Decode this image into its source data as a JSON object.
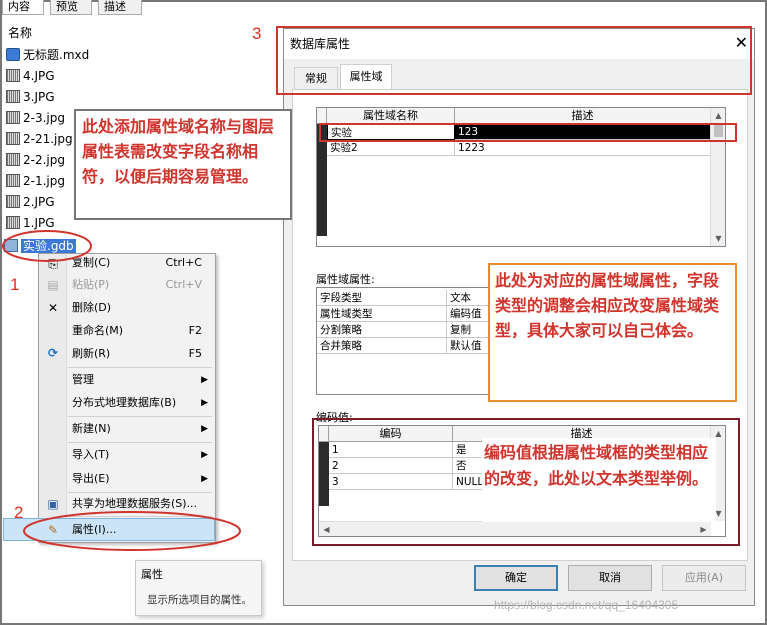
{
  "catalog": {
    "tabs": [
      "内容",
      "预览",
      "描述"
    ],
    "header": "名称",
    "items": [
      {
        "label": "无标题.mxd",
        "icon": "mxd-document-icon"
      },
      {
        "label": "4.JPG",
        "icon": "raster-icon"
      },
      {
        "label": "3.JPG",
        "icon": "raster-icon"
      },
      {
        "label": "2-3.jpg",
        "icon": "raster-icon"
      },
      {
        "label": "2-21.jpg",
        "icon": "raster-icon"
      },
      {
        "label": "2-2.jpg",
        "icon": "raster-icon"
      },
      {
        "label": "2-1.jpg",
        "icon": "raster-icon"
      },
      {
        "label": "2.JPG",
        "icon": "raster-icon"
      },
      {
        "label": "1.JPG",
        "icon": "raster-icon"
      },
      {
        "label": "实验.gdb",
        "icon": "geodatabase-icon",
        "selected": true
      }
    ]
  },
  "context_menu": {
    "items": [
      {
        "label": "复制(C)",
        "shortcut": "Ctrl+C",
        "icon": "copy-icon"
      },
      {
        "label": "粘贴(P)",
        "shortcut": "Ctrl+V",
        "icon": "paste-icon",
        "disabled": true
      },
      {
        "label": "删除(D)",
        "shortcut": "",
        "icon": "delete-icon"
      },
      {
        "label": "重命名(M)",
        "shortcut": "F2",
        "icon": ""
      },
      {
        "label": "刷新(R)",
        "shortcut": "F5",
        "icon": "refresh-icon"
      },
      {
        "label": "管理",
        "submenu": true
      },
      {
        "label": "分布式地理数据库(B)",
        "submenu": true
      },
      {
        "label": "新建(N)",
        "submenu": true
      },
      {
        "label": "导入(T)",
        "submenu": true
      },
      {
        "label": "导出(E)",
        "submenu": true
      },
      {
        "label": "共享为地理数据服务(S)...",
        "icon": "share-icon"
      },
      {
        "label": "属性(I)...",
        "icon": "properties-icon",
        "highlighted": true
      }
    ]
  },
  "tooltip": {
    "title": "属性",
    "text": "显示所选项目的属性。"
  },
  "dialog": {
    "title": "数据库属性",
    "tabs": [
      "常规",
      "属性域"
    ],
    "active_tab": "属性域",
    "domains_table": {
      "columns": [
        "属性域名称",
        "描述"
      ],
      "rows": [
        {
          "name": "实验",
          "description": "123"
        },
        {
          "name": "实验2",
          "description": "1223"
        }
      ]
    },
    "domain_properties": {
      "label": "属性域属性:",
      "rows": [
        {
          "key": "字段类型",
          "value": "文本"
        },
        {
          "key": "属性域类型",
          "value": "编码值"
        },
        {
          "key": "分割策略",
          "value": "复制"
        },
        {
          "key": "合并策略",
          "value": "默认值"
        }
      ]
    },
    "coded_values": {
      "label": "编码值:",
      "columns": [
        "编码",
        "描述"
      ],
      "rows": [
        {
          "code": "1",
          "description": "是"
        },
        {
          "code": "2",
          "description": "否"
        },
        {
          "code": "3",
          "description": "NULL"
        }
      ]
    },
    "buttons": {
      "ok": "确定",
      "cancel": "取消",
      "apply": "应用(A)"
    }
  },
  "annotations": {
    "num1": "1",
    "num2": "2",
    "num3": "3",
    "note_domain_name": "此处添加属性域名称与图层属性表需改变字段名称相符，以便后期容易管理。",
    "note_domain_props": "此处为对应的属性域属性，字段类型的调整会相应改变属性域类型，具体大家可以自己体会。",
    "note_coded_values": "编码值根据属性域框的类型相应的改变，此处以文本类型举例。"
  },
  "watermark": "https://blog.csdn.net/qq_16404305",
  "colors": {
    "annotation_red": "#d0342c",
    "annotation_orange": "#e88a2e",
    "annotation_darkred": "#7a1b2a",
    "selection_blue": "#cce4f7"
  }
}
